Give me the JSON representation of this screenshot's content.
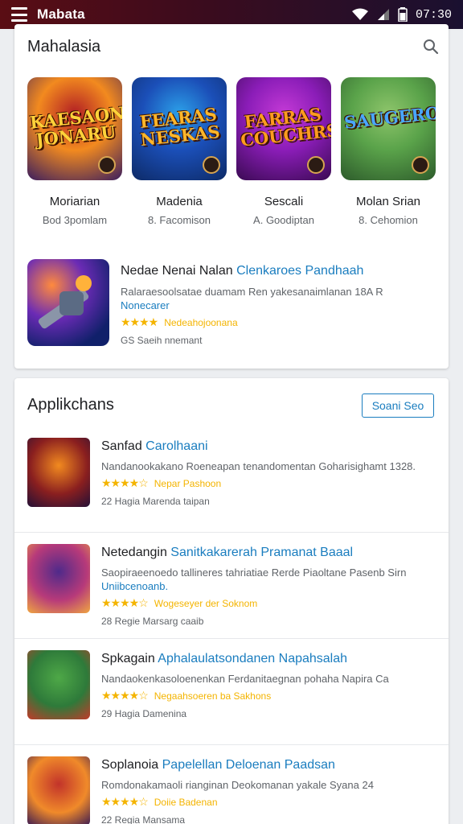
{
  "statusbar": {
    "app_title": "Mabata",
    "time": "07:30"
  },
  "section1": {
    "title": "Mahalasia",
    "featured": [
      {
        "art": "KAESAON JONARU",
        "name": "Moriarian",
        "sub": "Bod 3pomlam",
        "colors": [
          "#f28a1f",
          "#b21f24",
          "#3a1d5e"
        ],
        "art_color": "#ffd23a"
      },
      {
        "art": "FEARAS NESKAS",
        "name": "Madenia",
        "sub": "8. Facomison",
        "colors": [
          "#1b4fb8",
          "#2ca0e8",
          "#0d2a66"
        ],
        "art_color": "#ffb62b"
      },
      {
        "art": "FARRAS COUCHRS",
        "name": "Sescali",
        "sub": "A. Goodiptan",
        "colors": [
          "#8b1db8",
          "#c43ad6",
          "#3a0a52"
        ],
        "art_color": "#ff9c1f"
      },
      {
        "art": "SAUGEROIN",
        "name": "Molan Srian",
        "sub": "8. Cehomion",
        "colors": [
          "#5aa34a",
          "#8ec56b",
          "#2d5b2b"
        ],
        "art_color": "#49a6ff"
      }
    ],
    "promo": {
      "title_main": "Nedae Nenai Nalan ",
      "title_link": "Clenkaroes Pandhaah",
      "desc": "Ralaraesoolsatae duamam Ren yakesanaimlanan 18A R",
      "desc_link": "Nonecarer",
      "rating_label": "Nedeahojoonana",
      "meta": "GS Saeih nnemant"
    }
  },
  "section2": {
    "title": "Applikchans",
    "see_more": "Soani Seo",
    "rows": [
      {
        "title_main": "Sanfad ",
        "title_link": "Carolhaani",
        "desc": "Nandanookakano Roeneapan tenandomentan Goharisighamt 1328.",
        "desc_link": "",
        "rating_label": "Nepar Pashoon",
        "meta": "22 Hagia Marenda taipan",
        "colors": [
          "#f28a1f",
          "#8a1f1f",
          "#241036"
        ]
      },
      {
        "title_main": "Netedangin ",
        "title_link": "Sanitkakarerah Pramanat Baaal",
        "desc": "Saopiraeenoedo tallineres tahriatiae Rerde Piaoltane Pasenb Sirn",
        "desc_link": "Uniibcenoanb.",
        "rating_label": "Wogeseyer der Soknom",
        "meta": "28 Regie Marsarg caaib",
        "colors": [
          "#4f2a8a",
          "#b73a7a",
          "#f0a640"
        ]
      },
      {
        "title_main": "Spkagain ",
        "title_link": "Aphalaulatsondanen Napahsalah",
        "desc": "Nandaokenkasoloenenkan Ferdanitaegnan pohaha Napira Ca",
        "desc_link": "",
        "rating_label": "Negaahsoeren ba Sakhons",
        "meta": "29 Hagia Damenina",
        "colors": [
          "#4ea847",
          "#2e7a3a",
          "#c23a2a"
        ]
      },
      {
        "title_main": "Soplanoia ",
        "title_link": "Papelellan Deloenan Paadsan",
        "desc": "Romdonakamaoli rianginan Deokomanan yakale Syana 24",
        "desc_link": "",
        "rating_label": "Doiie Badenan",
        "meta": "22 Regia Mansama",
        "colors": [
          "#c2332a",
          "#f08a2a",
          "#3a1a52"
        ]
      }
    ]
  }
}
